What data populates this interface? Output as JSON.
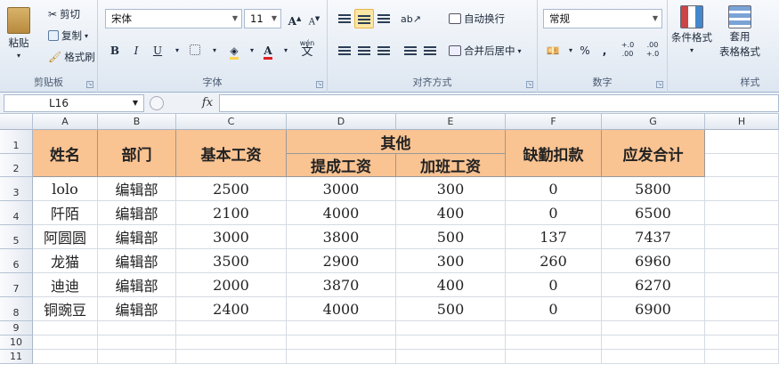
{
  "ribbon": {
    "clipboard": {
      "paste": "粘贴",
      "cut": "剪切",
      "copy": "复制",
      "format_painter": "格式刷",
      "group_label": "剪贴板"
    },
    "font": {
      "family": "宋体",
      "size": "11",
      "grow": "A",
      "shrink": "A",
      "bold": "B",
      "italic": "I",
      "underline": "U",
      "phonetic": "wén",
      "group_label": "字体"
    },
    "alignment": {
      "wrap_text": "自动换行",
      "merge_center": "合并后居中",
      "group_label": "对齐方式"
    },
    "number": {
      "format": "常规",
      "percent": "%",
      "comma": ",",
      "inc_decimal": "+.0 .00",
      "dec_decimal": ".00 +.0",
      "group_label": "数字"
    },
    "styles": {
      "conditional": "条件格式",
      "table_format_line1": "套用",
      "table_format_line2": "表格格式",
      "group_label": "样式"
    },
    "accent": "#fde7a4",
    "font_color": "#e02020",
    "fill_color": "#ffd34d"
  },
  "formula_bar": {
    "name_box": "L16",
    "fx": "fx",
    "value": ""
  },
  "columns": [
    "A",
    "B",
    "C",
    "D",
    "E",
    "F",
    "G",
    "H"
  ],
  "rows": [
    "1",
    "2",
    "3",
    "4",
    "5",
    "6",
    "7",
    "8",
    "9",
    "10",
    "11"
  ],
  "table": {
    "header_color": "#f9c392",
    "headers": {
      "name": "姓名",
      "dept": "部门",
      "base": "基本工资",
      "other": "其他",
      "commission": "提成工资",
      "overtime": "加班工资",
      "deduction": "缺勤扣款",
      "total": "应发合计"
    },
    "data": [
      [
        "lolo",
        "编辑部",
        "2500",
        "3000",
        "300",
        "0",
        "5800"
      ],
      [
        "阡陌",
        "编辑部",
        "2100",
        "4000",
        "400",
        "0",
        "6500"
      ],
      [
        "阿圆圆",
        "编辑部",
        "3000",
        "3800",
        "500",
        "137",
        "7437"
      ],
      [
        "龙猫",
        "编辑部",
        "3500",
        "2900",
        "300",
        "260",
        "6960"
      ],
      [
        "迪迪",
        "编辑部",
        "2000",
        "3870",
        "400",
        "0",
        "6270"
      ],
      [
        "铜豌豆",
        "编辑部",
        "2400",
        "4000",
        "500",
        "0",
        "6900"
      ]
    ]
  }
}
